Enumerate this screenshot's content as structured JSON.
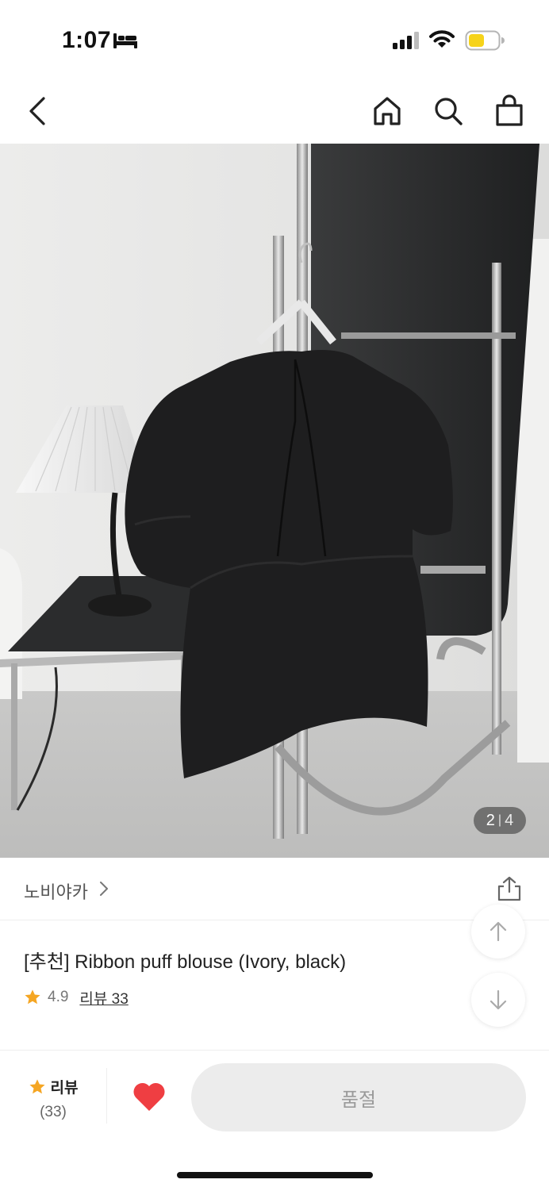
{
  "status_bar": {
    "time": "1:07",
    "sleep_icon": "bed-icon",
    "signal_icon": "cellular-signal-icon",
    "wifi_icon": "wifi-icon",
    "battery_icon": "battery-icon",
    "battery_color": "#f6d31a"
  },
  "nav": {
    "back_icon": "chevron-left-icon",
    "home_icon": "home-icon",
    "search_icon": "search-icon",
    "cart_icon": "shopping-bag-icon"
  },
  "gallery": {
    "current_index": "2",
    "separator": "|",
    "total": "4"
  },
  "product": {
    "brand": "노비야카",
    "brand_chevron_icon": "chevron-right-icon",
    "share_icon": "share-icon",
    "title": "[추천] Ribbon puff blouse (Ivory, black)",
    "rating": "4.9",
    "review_link": "리뷰 33",
    "star_color": "#f5a623"
  },
  "floating": {
    "scroll_top_icon": "arrow-up-icon",
    "scroll_down_icon": "arrow-down-icon"
  },
  "bottom_bar": {
    "review_label": "리뷰",
    "review_count": "(33)",
    "wish_icon": "heart-icon",
    "wish_color": "#ef3e42",
    "soldout_label": "품절"
  }
}
